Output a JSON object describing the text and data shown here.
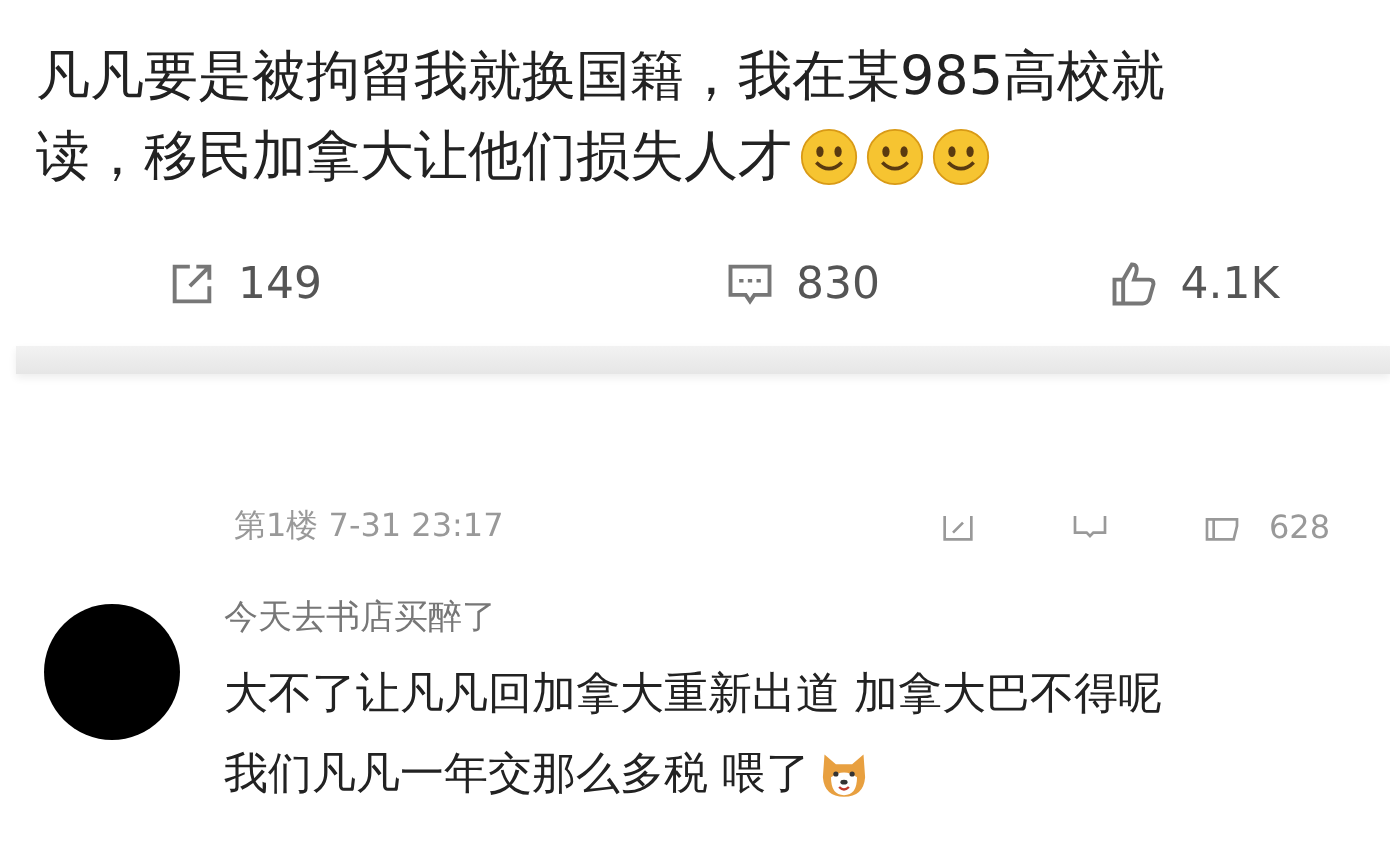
{
  "post": {
    "lines": [
      "凡凡要是被拘留我就换国籍，我在某985高校就",
      "读，移民加拿大让他们损失人才"
    ],
    "stats": [
      {
        "kind": "share",
        "count": "149"
      },
      {
        "kind": "comment",
        "count": "830"
      },
      {
        "kind": "like",
        "count": "4.1K"
      }
    ]
  },
  "reply_meta": {
    "floor": "第1楼 7-31 23:17",
    "like_count": "628"
  },
  "comment": {
    "author": "今天去书店买醉了",
    "lines": [
      "大不了让凡凡回加拿大重新出道 加拿大巴不得呢",
      "我们凡凡一年交那么多税 喂了"
    ]
  }
}
